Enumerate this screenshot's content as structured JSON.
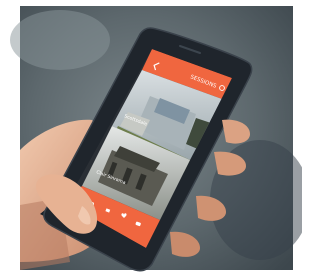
{
  "scene": {
    "subject": "hand holding smartphone",
    "background_color": "#4d5a60",
    "phone_color": "#1b2026",
    "accent_color": "#f0663f"
  },
  "app": {
    "header_title": "SESSIONS",
    "back_icon": "chevron-left-icon",
    "filter_icon": "circle-icon",
    "cards": [
      {
        "label": "Scottsdale",
        "image": "modern-glass-building"
      },
      {
        "label": "Clair Sinrama",
        "image": "historic-gate-monument"
      }
    ],
    "bottom_icons": [
      "home-icon",
      "list-icon",
      "heart-icon",
      "chat-icon"
    ]
  }
}
